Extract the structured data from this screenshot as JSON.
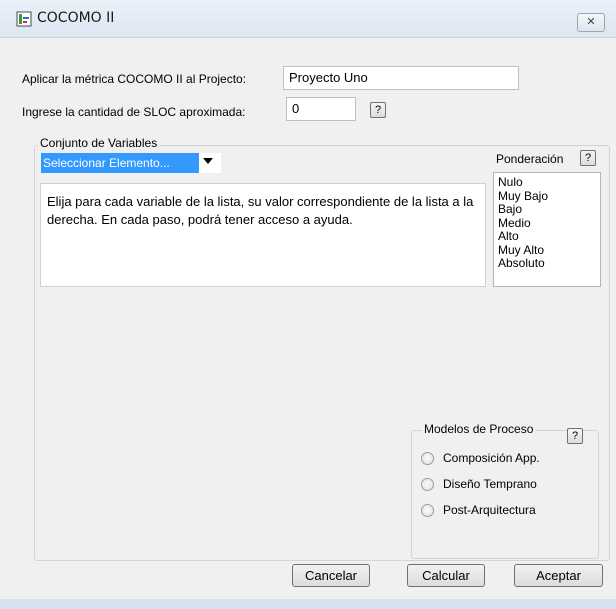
{
  "window": {
    "title": "COCOMO II",
    "close_glyph": "✕"
  },
  "project": {
    "label": "Aplicar la métrica COCOMO II al  Projecto:",
    "value": "Proyecto Uno"
  },
  "sloc": {
    "label": "Ingrese la cantidad de SLOC aproximada:",
    "value": "0",
    "help": "?"
  },
  "variables": {
    "group_title": "Conjunto de Variables",
    "combo_selected": "Seleccionar Elemento...",
    "description": "Elija para cada variable de la lista, su valor correspondiente de la lista a la derecha.   En cada paso, podrá tener acceso a ayuda."
  },
  "ponderacion": {
    "label": "Ponderación",
    "help": "?",
    "options": [
      "Nulo",
      "Muy Bajo",
      "Bajo",
      "Medio",
      "Alto",
      "Muy Alto",
      "Absoluto"
    ]
  },
  "modelos": {
    "group_title": "Modelos de Proceso",
    "help": "?",
    "options": [
      "Composición App.",
      "Diseño Temprano",
      "Post-Arquitectura"
    ]
  },
  "buttons": {
    "cancel": "Cancelar",
    "calc": "Calcular",
    "accept": "Aceptar"
  }
}
